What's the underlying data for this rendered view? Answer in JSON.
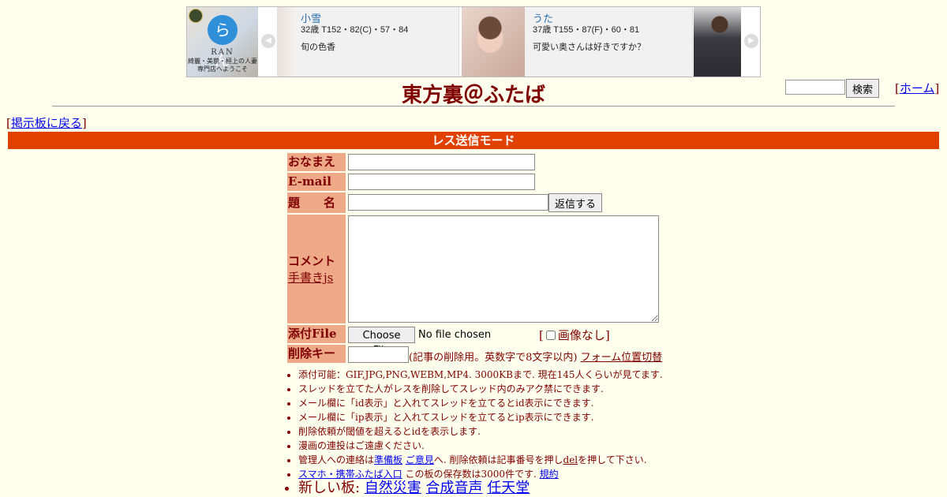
{
  "ad": {
    "logo_text": "RAN",
    "logo_char": "らん",
    "logo_tag": "綺麗・美貌・極上の人妻専門店へようこそ",
    "cards": [
      {
        "name": "小雪",
        "spec": "32歳 T152・82(C)・57・84",
        "desc": "旬の色香"
      },
      {
        "name": "うた",
        "spec": "37歳 T155・87(F)・60・81",
        "desc": "可愛い奥さんは好きですか？"
      }
    ],
    "prev_icon": "chevron-left-icon",
    "next_icon": "chevron-right-icon"
  },
  "header": {
    "title": "東方裏＠ふたば",
    "search_button": "検索",
    "home_link": "ホーム"
  },
  "nav": {
    "back_link": "掲示板に戻る"
  },
  "mode_label": "レス送信モード",
  "form": {
    "name_label": "おなまえ",
    "email_label": "E-mail",
    "subject_label": "題　　名",
    "submit_button": "返信する",
    "comment_label": "コメント",
    "handwriting_link": "手書きjs",
    "file_label": "添付File",
    "choose_file_button": "Choose File",
    "no_file_text": "No file chosen",
    "no_image_label": "画像なし",
    "delete_key_label": "削除キー",
    "delete_key_note": "(記事の削除用。英数字で8文字以内)",
    "form_position_link": "フォーム位置切替"
  },
  "notes": {
    "n1": "添付可能：GIF,JPG,PNG,WEBM,MP4. 3000KBまで. 現在145人くらいが見てます.",
    "n2": "スレッドを立てた人がレスを削除してスレッド内のみアク禁にできます.",
    "n3": "メール欄に「id表示」と入れてスレッドを立てるとid表示にできます.",
    "n4": "メール欄に「ip表示」と入れてスレッドを立てるとip表示にできます.",
    "n5": "削除依頼が閾値を超えるとidを表示します.",
    "n6": "漫画の連投はご遠慮ください.",
    "n7_pre": "管理人への連絡は",
    "n7_link1": "準備板",
    "n7_link2": "ご意見",
    "n7_mid": "へ. 削除依頼は記事番号を押し",
    "n7_del": "del",
    "n7_post": "を押して下さい.",
    "n8_link": "スマホ・携帯ふたば入口",
    "n8_text": "この板の保存数は3000件です.",
    "n8_link2": "規約",
    "n9_label": "新しい板:",
    "n9_boards": [
      "自然災害",
      "合成音声",
      "任天堂"
    ]
  }
}
